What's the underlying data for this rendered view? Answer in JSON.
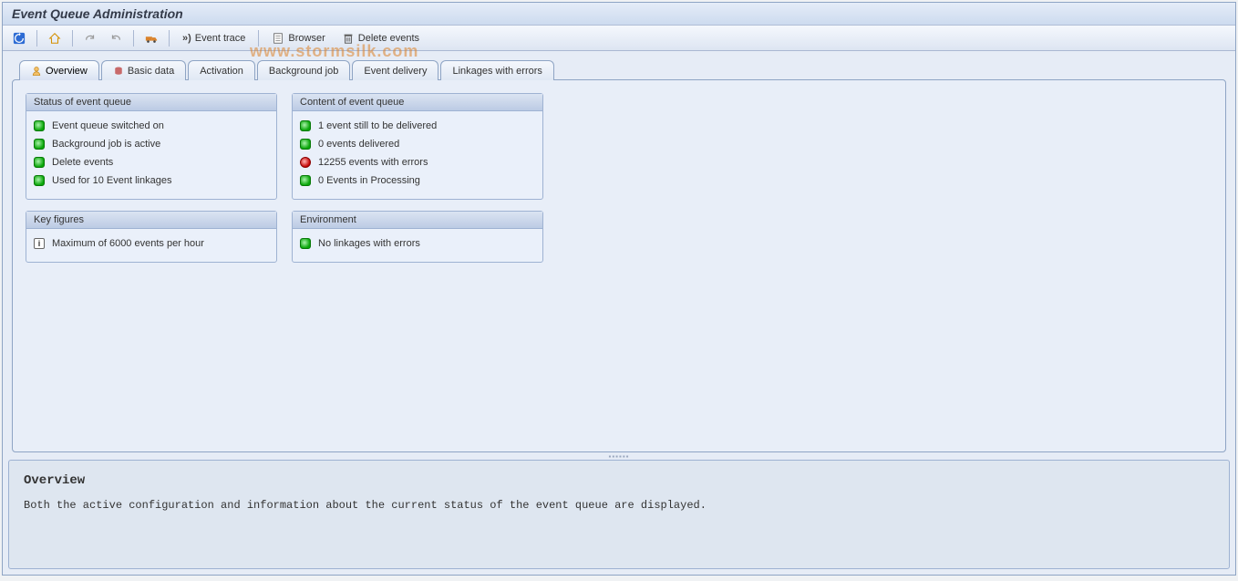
{
  "title": "Event Queue Administration",
  "toolbar": {
    "event_trace_label": "Event trace",
    "browser_label": "Browser",
    "delete_events_label": "Delete events"
  },
  "tabs": {
    "overview": "Overview",
    "basic_data": "Basic data",
    "activation": "Activation",
    "background_job": "Background job",
    "event_delivery": "Event delivery",
    "linkages_with_errors": "Linkages with errors"
  },
  "groups": {
    "status": {
      "title": "Status of event queue",
      "items": [
        "Event queue switched on",
        "Background job is active",
        "Delete events",
        "Used for 10 Event linkages"
      ]
    },
    "content": {
      "title": "Content of event queue",
      "items": [
        "1 event still to be delivered",
        "0 events delivered",
        "12255 events with errors",
        "0 Events in Processing"
      ]
    },
    "keyfigures": {
      "title": "Key figures",
      "items": [
        "Maximum of 6000 events per hour"
      ]
    },
    "environment": {
      "title": "Environment",
      "items": [
        "No linkages with errors"
      ]
    }
  },
  "help": {
    "heading": "Overview",
    "body": "Both the active configuration and information about the current status of the event queue are displayed."
  },
  "watermark": "www.stormsilk.com"
}
